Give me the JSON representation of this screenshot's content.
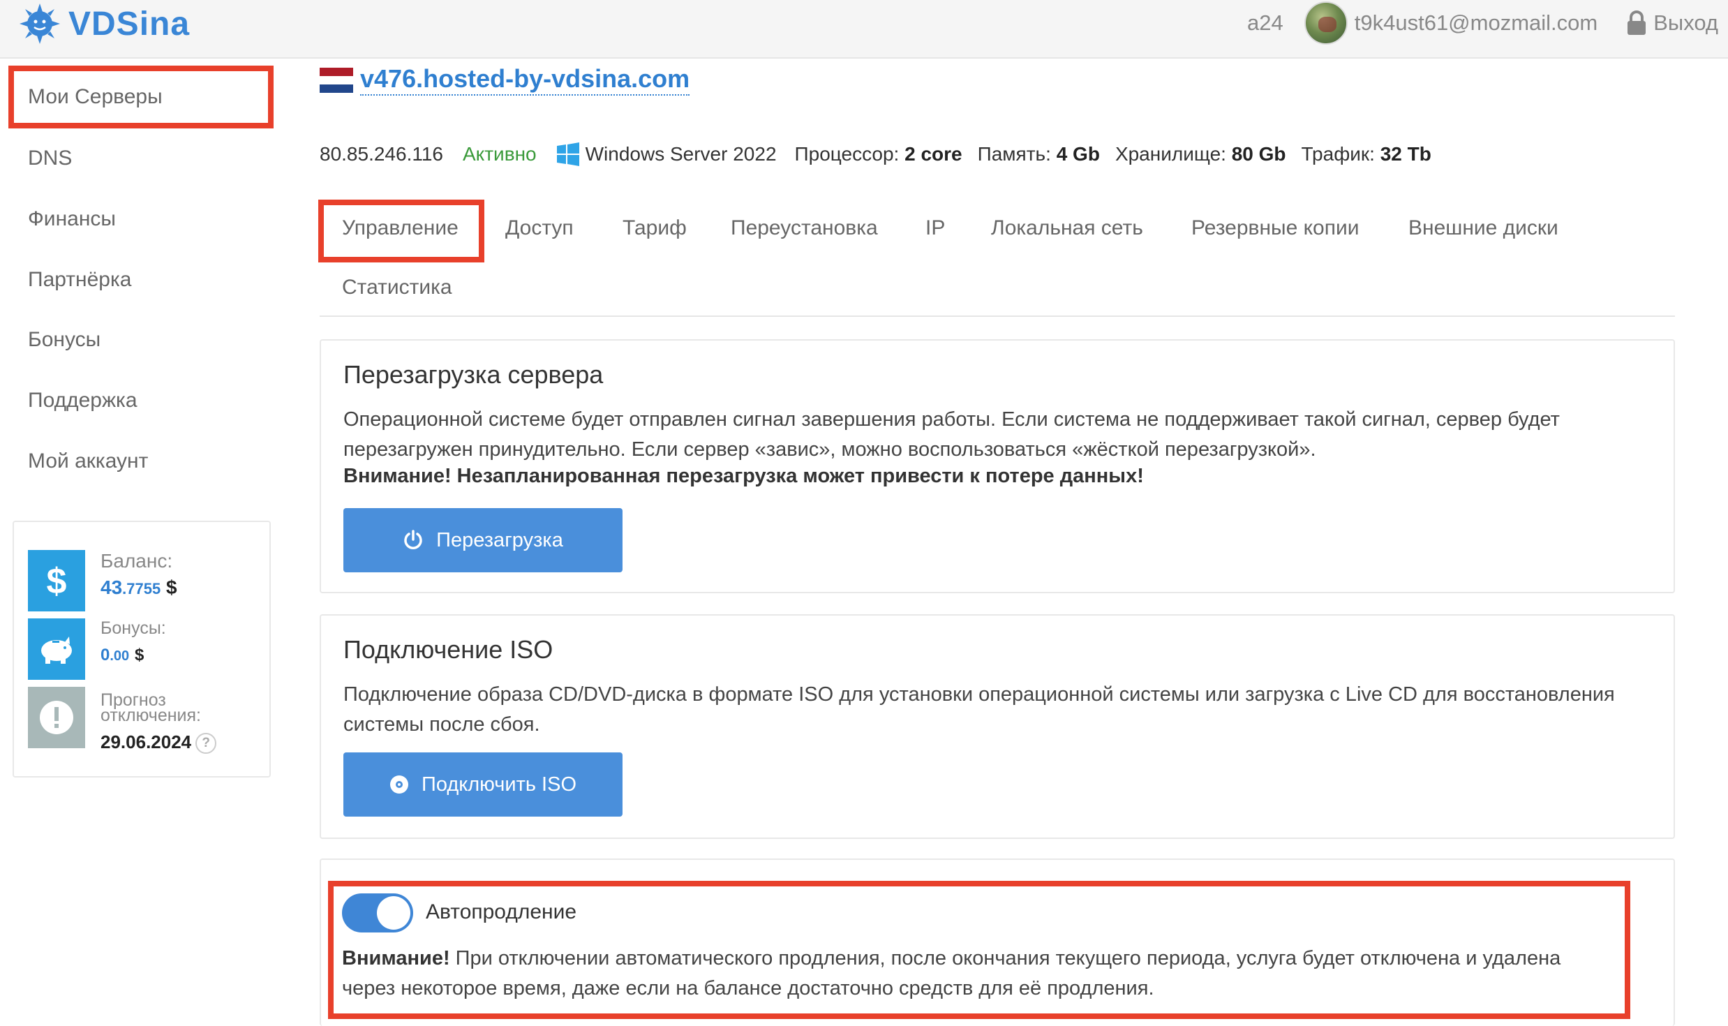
{
  "header": {
    "logo_text": "VDSina",
    "account": "a24",
    "email": "t9k4ust61@mozmail.com",
    "logout_label": "Выход"
  },
  "sidebar": {
    "items": [
      {
        "label": "Мои Серверы",
        "active": true
      },
      {
        "label": "DNS"
      },
      {
        "label": "Финансы"
      },
      {
        "label": "Партнёрка"
      },
      {
        "label": "Бонусы"
      },
      {
        "label": "Поддержка"
      },
      {
        "label": "Мой аккаунт"
      }
    ],
    "balance": {
      "balance_label": "Баланс:",
      "balance_int": "43",
      "balance_dec": ".7755",
      "currency": "$",
      "bonus_label": "Бонусы:",
      "bonus_int": "0",
      "bonus_dec": ".00",
      "forecast_label_line1": "Прогноз",
      "forecast_label_line2": "отключения:",
      "forecast_date": "29.06.2024",
      "help": "?"
    }
  },
  "server": {
    "name": "v476.hosted-by-vdsina.com",
    "ip": "80.85.246.116",
    "status": "Активно",
    "os": "Windows Server 2022",
    "cpu_label": "Процессор:",
    "cpu_value": "2 core",
    "ram_label": "Память:",
    "ram_value": "4 Gb",
    "storage_label": "Хранилище:",
    "storage_value": "80 Gb",
    "traffic_label": "Трафик:",
    "traffic_value": "32 Tb"
  },
  "tabs": [
    {
      "label": "Управление",
      "active": true
    },
    {
      "label": "Доступ"
    },
    {
      "label": "Тариф"
    },
    {
      "label": "Переустановка"
    },
    {
      "label": "IP"
    },
    {
      "label": "Локальная сеть"
    },
    {
      "label": "Резервные копии"
    },
    {
      "label": "Внешние диски"
    },
    {
      "label": "Статистика"
    }
  ],
  "reboot": {
    "title": "Перезагрузка сервера",
    "description": "Операционной системе будет отправлен сигнал завершения работы. Если система не поддерживает такой сигнал, сервер будет перезагружен принудительно. Если сервер «завис», можно воспользоваться «жёсткой перезагрузкой».",
    "warning": "Внимание! Незапланированная перезагрузка может привести к потере данных!",
    "button": "Перезагрузка"
  },
  "iso": {
    "title": "Подключение ISO",
    "description": "Подключение образа CD/DVD-диска в формате ISO для установки операционной системы или загрузка с Live CD для восстановления системы после сбоя.",
    "button": "Подключить ISO"
  },
  "autorenew": {
    "label": "Автопродление",
    "enabled": true,
    "warning_bold": "Внимание!",
    "warning_text": " При отключении автоматического продления, после окончания текущего периода, услуга будет отключена и удалена через некоторое время, даже если на балансе достаточно средств для её продления."
  },
  "colors": {
    "accent": "#4a8fdb",
    "link": "#2f7fd0",
    "active_status": "#3a9a3a",
    "highlight": "#e8402b"
  },
  "icons": {
    "logo": "sun-logo-icon",
    "lock": "lock-icon",
    "windows": "windows-icon",
    "flag": "netherlands-flag-icon",
    "power": "power-icon",
    "disc": "disc-icon",
    "dollar": "dollar-icon",
    "piggy": "piggy-bank-icon",
    "alert": "exclamation-icon"
  }
}
